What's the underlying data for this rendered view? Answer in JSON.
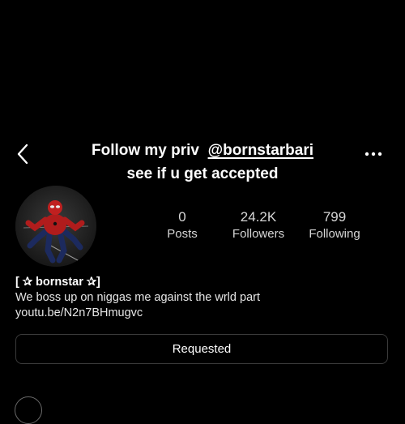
{
  "header": {
    "title_line1_prefix": "Follow my priv  ",
    "title_handle": "@bornstarbari",
    "title_line2": "see if u get accepted",
    "back_icon": "chevron-left-icon",
    "more_icon": "more-horizontal-icon"
  },
  "profile": {
    "avatar": "spiderman-avatar",
    "stats": [
      {
        "value": "0",
        "label": "Posts"
      },
      {
        "value": "24.2K",
        "label": "Followers"
      },
      {
        "value": "799",
        "label": "Following"
      }
    ],
    "bio": {
      "name": "[ ✰ bornstar ✰]",
      "text": "We boss up on niggas me against the wrld part",
      "link": "youtu.be/N2n7BHmugvc"
    }
  },
  "actions": {
    "requested_label": "Requested"
  },
  "colors": {
    "background": "#000000",
    "text": "#ffffff",
    "stat_text": "#d6d6d6",
    "button_border": "#3a3a3a"
  }
}
